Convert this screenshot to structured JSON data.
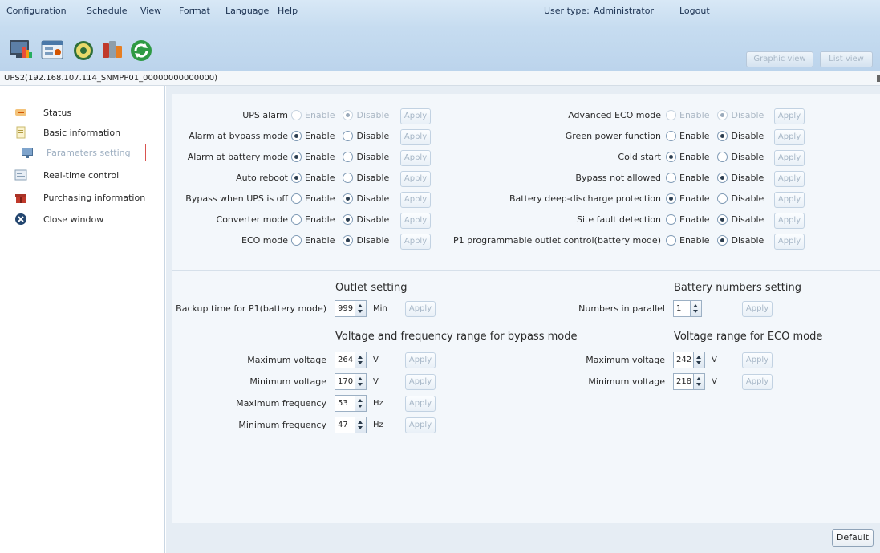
{
  "menu": [
    "Configuration",
    "Schedule",
    "View",
    "Format",
    "Language",
    "Help"
  ],
  "user": {
    "type_label": "User type:",
    "type_value": "Administrator",
    "logout": "Logout"
  },
  "toolbar_icons": [
    "monitor-icon",
    "settings-panel-icon",
    "disc-icon",
    "tools-icon",
    "refresh-icon"
  ],
  "view_buttons": {
    "graphic": "Graphic view",
    "list": "List view"
  },
  "path": "UPS2(192.168.107.114_SNMPP01_00000000000000)",
  "sidebar": {
    "items": [
      {
        "label": "Status",
        "icon": "status-icon"
      },
      {
        "label": "Basic information",
        "icon": "document-icon"
      },
      {
        "label": "Parameters setting",
        "icon": "monitor-icon",
        "active": true
      },
      {
        "label": "Real-time control",
        "icon": "control-icon"
      },
      {
        "label": "Purchasing information",
        "icon": "gift-icon"
      },
      {
        "label": "Close window",
        "icon": "close-icon"
      }
    ]
  },
  "options": {
    "enable_label": "Enable",
    "disable_label": "Disable",
    "apply_label": "Apply"
  },
  "left_settings": [
    {
      "label": "UPS alarm",
      "selected": "Disable",
      "disabled": true
    },
    {
      "label": "Alarm at bypass mode",
      "selected": "Enable",
      "disabled": false
    },
    {
      "label": "Alarm at battery mode",
      "selected": "Enable",
      "disabled": false
    },
    {
      "label": "Auto reboot",
      "selected": "Enable",
      "disabled": false
    },
    {
      "label": "Bypass when UPS is off",
      "selected": "Disable",
      "disabled": false
    },
    {
      "label": "Converter mode",
      "selected": "Disable",
      "disabled": false
    },
    {
      "label": "ECO mode",
      "selected": "Disable",
      "disabled": false
    }
  ],
  "right_settings": [
    {
      "label": "Advanced ECO mode",
      "selected": "Disable",
      "disabled": true
    },
    {
      "label": "Green power function",
      "selected": "Disable",
      "disabled": false
    },
    {
      "label": "Cold start",
      "selected": "Enable",
      "disabled": false
    },
    {
      "label": "Bypass not allowed",
      "selected": "Disable",
      "disabled": false
    },
    {
      "label": "Battery deep-discharge protection",
      "selected": "Enable",
      "disabled": false
    },
    {
      "label": "Site fault detection",
      "selected": "Disable",
      "disabled": false
    },
    {
      "label": "P1 programmable outlet control(battery mode)",
      "selected": "Disable",
      "disabled": false
    }
  ],
  "outlet": {
    "title": "Outlet setting",
    "backup_label": "Backup time for P1(battery mode)",
    "backup_value": "999",
    "backup_unit": "Min"
  },
  "battery": {
    "title": "Battery numbers setting",
    "parallel_label": "Numbers in parallel",
    "parallel_value": "1"
  },
  "bypass_range": {
    "title": "Voltage and frequency range for bypass mode",
    "rows": [
      {
        "label": "Maximum voltage",
        "value": "264",
        "unit": "V"
      },
      {
        "label": "Minimum voltage",
        "value": "170",
        "unit": "V"
      },
      {
        "label": "Maximum frequency",
        "value": "53",
        "unit": "Hz"
      },
      {
        "label": "Minimum frequency",
        "value": "47",
        "unit": "Hz"
      }
    ]
  },
  "eco_range": {
    "title": "Voltage range for ECO mode",
    "rows": [
      {
        "label": "Maximum voltage",
        "value": "242",
        "unit": "V"
      },
      {
        "label": "Minimum voltage",
        "value": "218",
        "unit": "V"
      }
    ]
  },
  "default_button": "Default"
}
